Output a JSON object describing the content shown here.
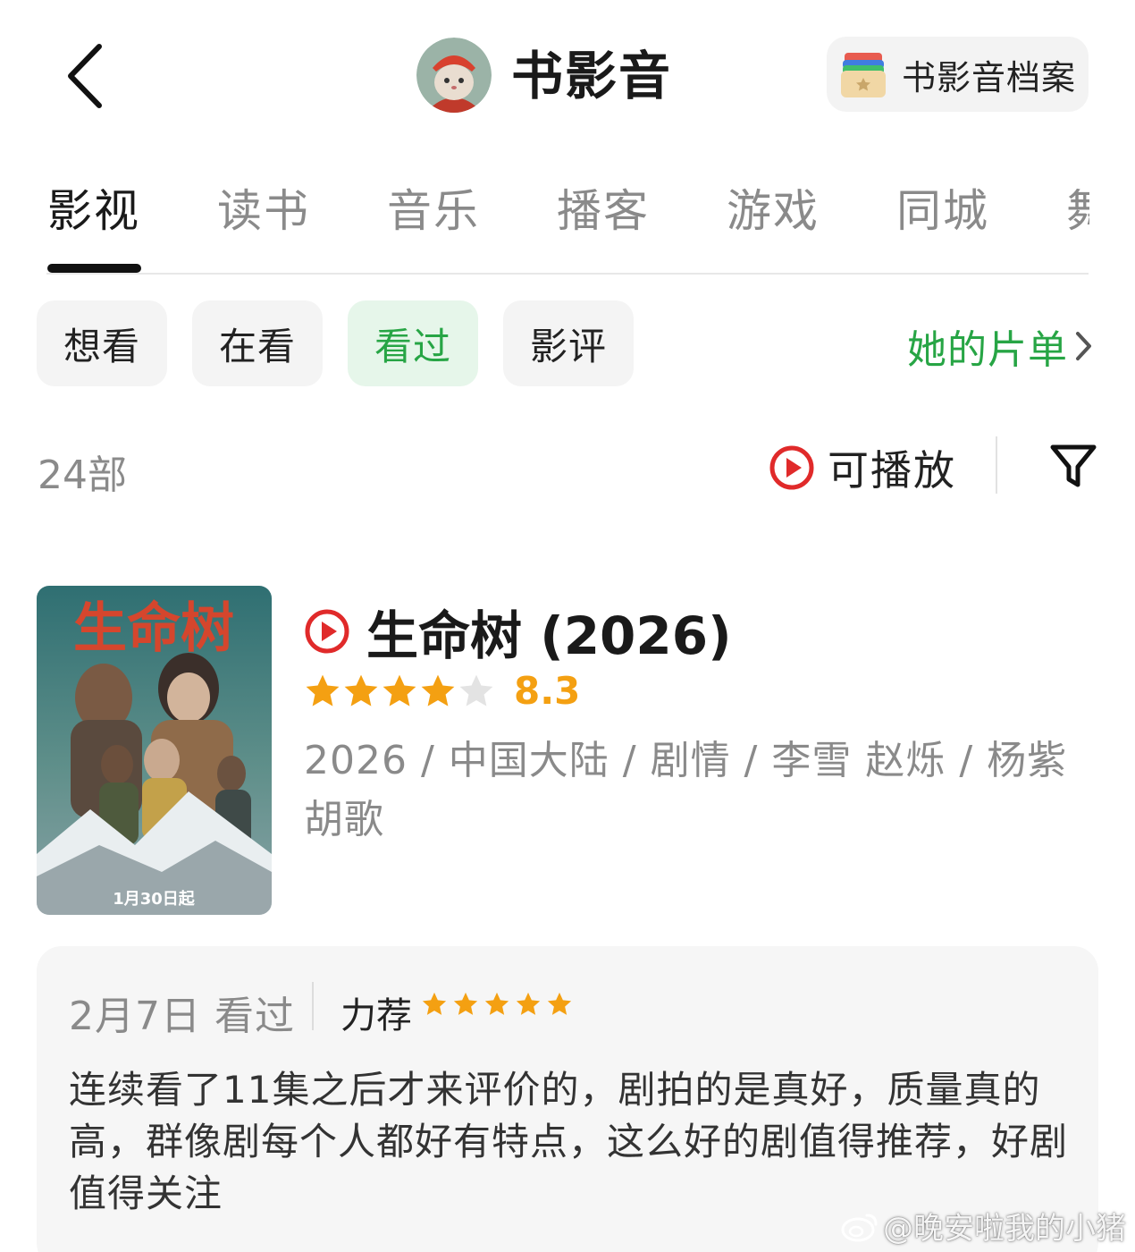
{
  "header": {
    "title": "书影音",
    "archive_label": "书影音档案"
  },
  "tabs": [
    {
      "label": "影视",
      "active": true
    },
    {
      "label": "读书",
      "active": false
    },
    {
      "label": "音乐",
      "active": false
    },
    {
      "label": "播客",
      "active": false
    },
    {
      "label": "游戏",
      "active": false
    },
    {
      "label": "同城",
      "active": false
    },
    {
      "label": "舞",
      "active": false
    }
  ],
  "filters": {
    "chips": [
      {
        "label": "想看",
        "active": false
      },
      {
        "label": "在看",
        "active": false
      },
      {
        "label": "看过",
        "active": true
      },
      {
        "label": "影评",
        "active": false
      }
    ],
    "playlist_label": "她的片单"
  },
  "toolbar": {
    "count": "24部",
    "playable_label": "可播放"
  },
  "movie": {
    "title": "生命树 (2026)",
    "rating": 8.3,
    "rating_label": "8.3",
    "stars_filled": 4,
    "stars_total": 5,
    "meta": "2026 / 中国大陆 / 剧情 / 李雪 赵烁 / 杨紫 胡歌",
    "poster": {
      "title_art": "生命树",
      "release_note": "1月30日起"
    }
  },
  "review": {
    "date": "2月7日 看过",
    "verdict": "力荐",
    "stars": 5,
    "text": "连续看了11集之后才来评价的，剧拍的是真好，质量真的高，群像剧每个人都好有特点，这么好的剧值得推荐，好剧值得关注"
  },
  "watermark": "@晚安啦我的小猪",
  "colors": {
    "accent_green": "#27a545",
    "chip_active_bg": "#e6f6ea",
    "star_orange": "#f4a012",
    "play_red": "#e02a2a"
  }
}
